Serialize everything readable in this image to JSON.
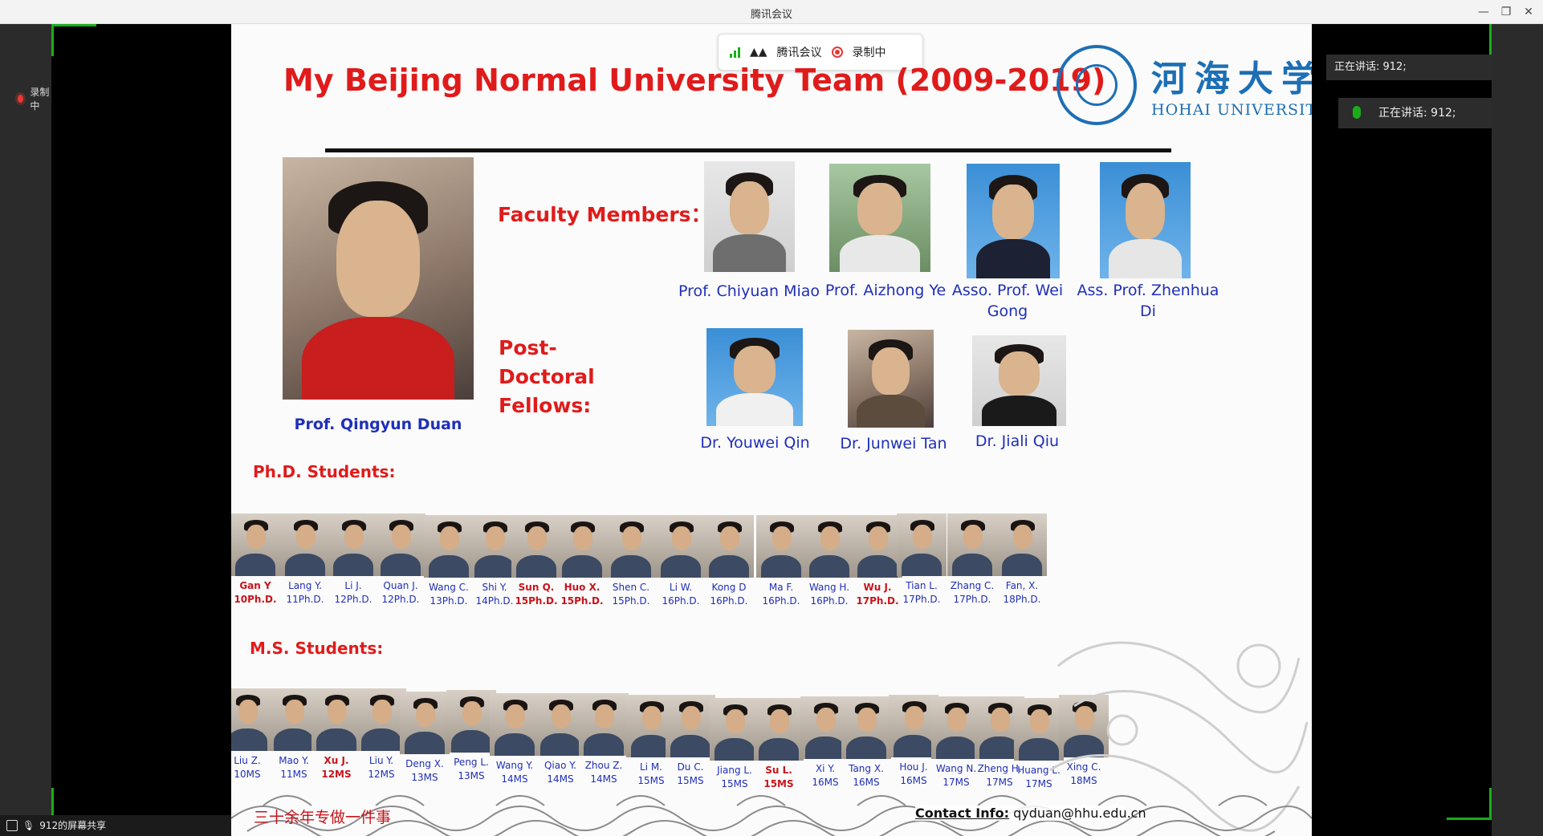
{
  "window": {
    "title": "腾讯会议",
    "recording_label": "录制中",
    "share_label": "912的屏幕共享",
    "speaker_text": "正在讲话: 912;",
    "speaker_text_2": "正在讲话: 912;"
  },
  "meeting_bar": {
    "app_label": "腾讯会议",
    "recording_label": "录制中"
  },
  "slide": {
    "title": "My Beijing Normal University Team (2009-2019)",
    "logo_cn": "河海大学",
    "logo_en": "HOHAI UNIVERSITY",
    "leader_name": "Prof. Qingyun Duan",
    "faculty_heading": "Faculty Members：",
    "faculty": [
      {
        "name": "Prof. Chiyuan Miao"
      },
      {
        "name": "Prof. Aizhong Ye"
      },
      {
        "name": "Asso. Prof. Wei Gong"
      },
      {
        "name": "Ass. Prof. Zhenhua Di"
      }
    ],
    "postdoc_heading": "Post-Doctoral Fellows:",
    "postdocs": [
      {
        "name": "Dr. Youwei Qin"
      },
      {
        "name": "Dr. Junwei Tan"
      },
      {
        "name": "Dr. Jiali Qiu"
      }
    ],
    "phd_heading": "Ph.D. Students:",
    "phd": [
      {
        "name": "Gan Y",
        "deg": "10Ph.D.",
        "highlight": true
      },
      {
        "name": "Lang Y.",
        "deg": "11Ph.D.",
        "highlight": false
      },
      {
        "name": "Li J.",
        "deg": "12Ph.D.",
        "highlight": false
      },
      {
        "name": "Quan J.",
        "deg": "12Ph.D.",
        "highlight": false
      },
      {
        "name": "Wang C.",
        "deg": "13Ph.D.",
        "highlight": false
      },
      {
        "name": "Shi Y.",
        "deg": "14Ph.D.",
        "highlight": false
      },
      {
        "name": "Sun Q.",
        "deg": "15Ph.D.",
        "highlight": true
      },
      {
        "name": "Huo X.",
        "deg": "15Ph.D.",
        "highlight": true
      },
      {
        "name": "Shen C.",
        "deg": "15Ph.D.",
        "highlight": false
      },
      {
        "name": "Li W.",
        "deg": "16Ph.D.",
        "highlight": false
      },
      {
        "name": "Kong D",
        "deg": "16Ph.D.",
        "highlight": false
      },
      {
        "name": "Ma F.",
        "deg": "16Ph.D.",
        "highlight": false
      },
      {
        "name": "Wang H.",
        "deg": "16Ph.D.",
        "highlight": false
      },
      {
        "name": "Wu J.",
        "deg": "17Ph.D.",
        "highlight": true
      },
      {
        "name": "Tian L.",
        "deg": "17Ph.D.",
        "highlight": false
      },
      {
        "name": "Zhang C.",
        "deg": "17Ph.D.",
        "highlight": false
      },
      {
        "name": "Fan, X.",
        "deg": "18Ph.D.",
        "highlight": false
      }
    ],
    "ms_heading": "M.S. Students:",
    "ms": [
      {
        "name": "Liu Z.",
        "deg": "10MS",
        "highlight": false
      },
      {
        "name": "Mao Y.",
        "deg": "11MS",
        "highlight": false
      },
      {
        "name": "Xu J.",
        "deg": "12MS",
        "highlight": true
      },
      {
        "name": "Liu Y.",
        "deg": "12MS",
        "highlight": false
      },
      {
        "name": "Deng X.",
        "deg": "13MS",
        "highlight": false
      },
      {
        "name": "Peng L.",
        "deg": "13MS",
        "highlight": false
      },
      {
        "name": "Wang Y.",
        "deg": "14MS",
        "highlight": false
      },
      {
        "name": "Qiao Y.",
        "deg": "14MS",
        "highlight": false
      },
      {
        "name": "Zhou Z.",
        "deg": "14MS",
        "highlight": false
      },
      {
        "name": "Li M.",
        "deg": "15MS",
        "highlight": false
      },
      {
        "name": "Du C.",
        "deg": "15MS",
        "highlight": false
      },
      {
        "name": "Jiang L.",
        "deg": "15MS",
        "highlight": false
      },
      {
        "name": "Su L.",
        "deg": "15MS",
        "highlight": true
      },
      {
        "name": "Xi Y.",
        "deg": "16MS",
        "highlight": false
      },
      {
        "name": "Tang X.",
        "deg": "16MS",
        "highlight": false
      },
      {
        "name": "Hou J.",
        "deg": "16MS",
        "highlight": false
      },
      {
        "name": "Wang N.",
        "deg": "17MS",
        "highlight": false
      },
      {
        "name": "Zheng H.",
        "deg": "17MS",
        "highlight": false
      },
      {
        "name": "Huang L.",
        "deg": "17MS",
        "highlight": false
      },
      {
        "name": "Xing C.",
        "deg": "18MS",
        "highlight": false
      }
    ],
    "slogan": "三十余年专做一件事",
    "contact_label": "Contact Info:",
    "contact_email": "qyduan@hhu.edu.cn"
  },
  "colors": {
    "title_red": "#e01b1b",
    "name_blue": "#1f2fb8",
    "logo_blue": "#1d6fb5",
    "active_green": "#1aad19"
  }
}
